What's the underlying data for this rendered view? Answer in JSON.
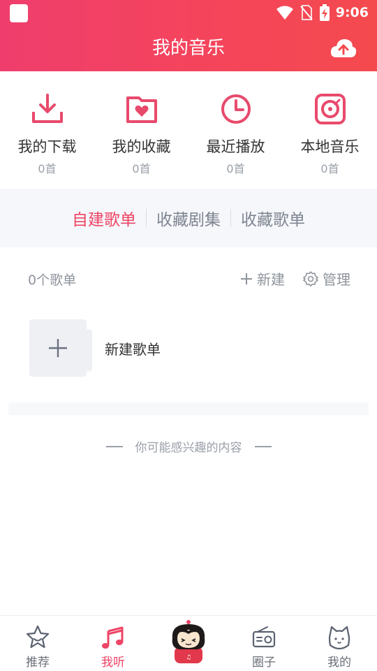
{
  "status": {
    "time": "9:06"
  },
  "header": {
    "title": "我的音乐"
  },
  "quick": [
    {
      "label": "我的下载",
      "count": "0首",
      "icon": "download-icon"
    },
    {
      "label": "我的收藏",
      "count": "0首",
      "icon": "heart-folder-icon"
    },
    {
      "label": "最近播放",
      "count": "0首",
      "icon": "clock-icon"
    },
    {
      "label": "本地音乐",
      "count": "0首",
      "icon": "vinyl-icon"
    }
  ],
  "tabs": [
    {
      "label": "自建歌单",
      "active": true
    },
    {
      "label": "收藏剧集",
      "active": false
    },
    {
      "label": "收藏歌单",
      "active": false
    }
  ],
  "playlists": {
    "count_text": "0个歌单",
    "new_label": "新建",
    "manage_label": "管理",
    "new_playlist_label": "新建歌单"
  },
  "interest": {
    "text": "你可能感兴趣的内容"
  },
  "nav": [
    {
      "label": "推荐",
      "icon": "star-face-icon"
    },
    {
      "label": "我听",
      "icon": "music-note-icon"
    },
    {
      "label": "",
      "icon": "avatar-character-icon"
    },
    {
      "label": "圈子",
      "icon": "radio-icon"
    },
    {
      "label": "我的",
      "icon": "cat-face-icon"
    }
  ],
  "colors": {
    "accent": "#ee4466",
    "header_start": "#ef3e6d",
    "header_end": "#f44a4e"
  }
}
